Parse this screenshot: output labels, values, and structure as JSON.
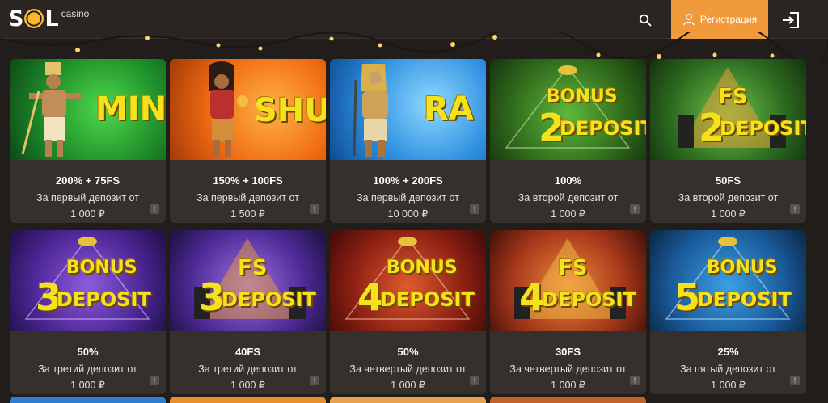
{
  "header": {
    "logo_text": "SOL",
    "logo_sub": "casino",
    "register_label": "Регистрация",
    "icons": [
      "search-icon",
      "user-icon",
      "login-icon"
    ],
    "accent_color": "#f09a3c"
  },
  "cards": [
    {
      "art": "MIN",
      "title": "200% + 75FS",
      "subtitle": "За первый депозит от",
      "amount": "1 000 ₽",
      "theme": "green"
    },
    {
      "art": "SHU",
      "title": "150% + 100FS",
      "subtitle": "За первый депозит от",
      "amount": "1 500 ₽",
      "theme": "orange"
    },
    {
      "art": "RA",
      "title": "100% + 200FS",
      "subtitle": "За первый депозит от",
      "amount": "10 000 ₽",
      "theme": "blue"
    },
    {
      "art": "BONUS 2 DEPOSIT",
      "title": "100%",
      "subtitle": "За второй депозит от",
      "amount": "1 000 ₽",
      "theme": "darkgreen"
    },
    {
      "art": "FS 2 DEPOSIT",
      "title": "50FS",
      "subtitle": "За второй депозит от",
      "amount": "1 000 ₽",
      "theme": "darkgreen2"
    },
    {
      "art": "BONUS 3 DEPOSIT",
      "title": "50%",
      "subtitle": "За третий депозит от",
      "amount": "1 000 ₽",
      "theme": "purple"
    },
    {
      "art": "FS 3 DEPOSIT",
      "title": "40FS",
      "subtitle": "За третий депозит от",
      "amount": "1 000 ₽",
      "theme": "purple2"
    },
    {
      "art": "BONUS 4 DEPOSIT",
      "title": "50%",
      "subtitle": "За четвертый депозит от",
      "amount": "1 000 ₽",
      "theme": "red"
    },
    {
      "art": "FS 4 DEPOSIT",
      "title": "30FS",
      "subtitle": "За четвертый депозит от",
      "amount": "1 000 ₽",
      "theme": "red2"
    },
    {
      "art": "BONUS 5 DEPOSIT",
      "title": "25%",
      "subtitle": "За пятый депозит от",
      "amount": "1 000 ₽",
      "theme": "blue2"
    }
  ]
}
